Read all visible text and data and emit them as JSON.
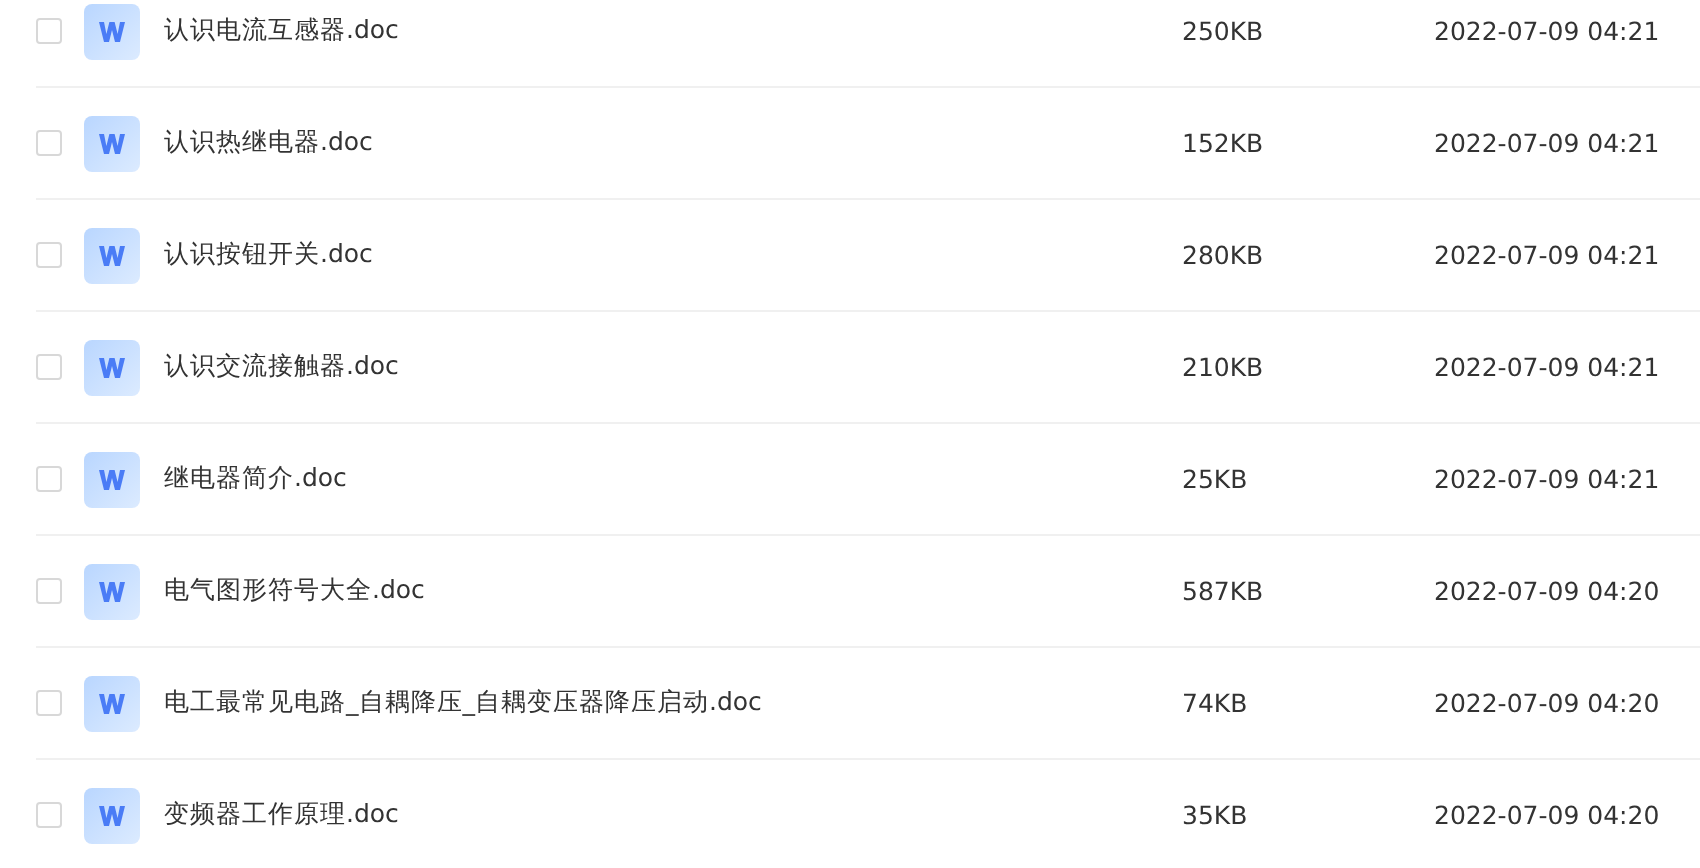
{
  "files": [
    {
      "name": "认识电流互感器.doc",
      "size": "250KB",
      "modified": "2022-07-09 04:21",
      "checked": false
    },
    {
      "name": "认识热继电器.doc",
      "size": "152KB",
      "modified": "2022-07-09 04:21",
      "checked": false
    },
    {
      "name": "认识按钮开关.doc",
      "size": "280KB",
      "modified": "2022-07-09 04:21",
      "checked": false
    },
    {
      "name": "认识交流接触器.doc",
      "size": "210KB",
      "modified": "2022-07-09 04:21",
      "checked": false
    },
    {
      "name": "继电器简介.doc",
      "size": "25KB",
      "modified": "2022-07-09 04:21",
      "checked": false
    },
    {
      "name": "电气图形符号大全.doc",
      "size": "587KB",
      "modified": "2022-07-09 04:20",
      "checked": false
    },
    {
      "name": "电工最常见电路_自耦降压_自耦变压器降压启动.doc",
      "size": "74KB",
      "modified": "2022-07-09 04:20",
      "checked": false
    },
    {
      "name": "变频器工作原理.doc",
      "size": "35KB",
      "modified": "2022-07-09 04:20",
      "checked": false
    }
  ]
}
